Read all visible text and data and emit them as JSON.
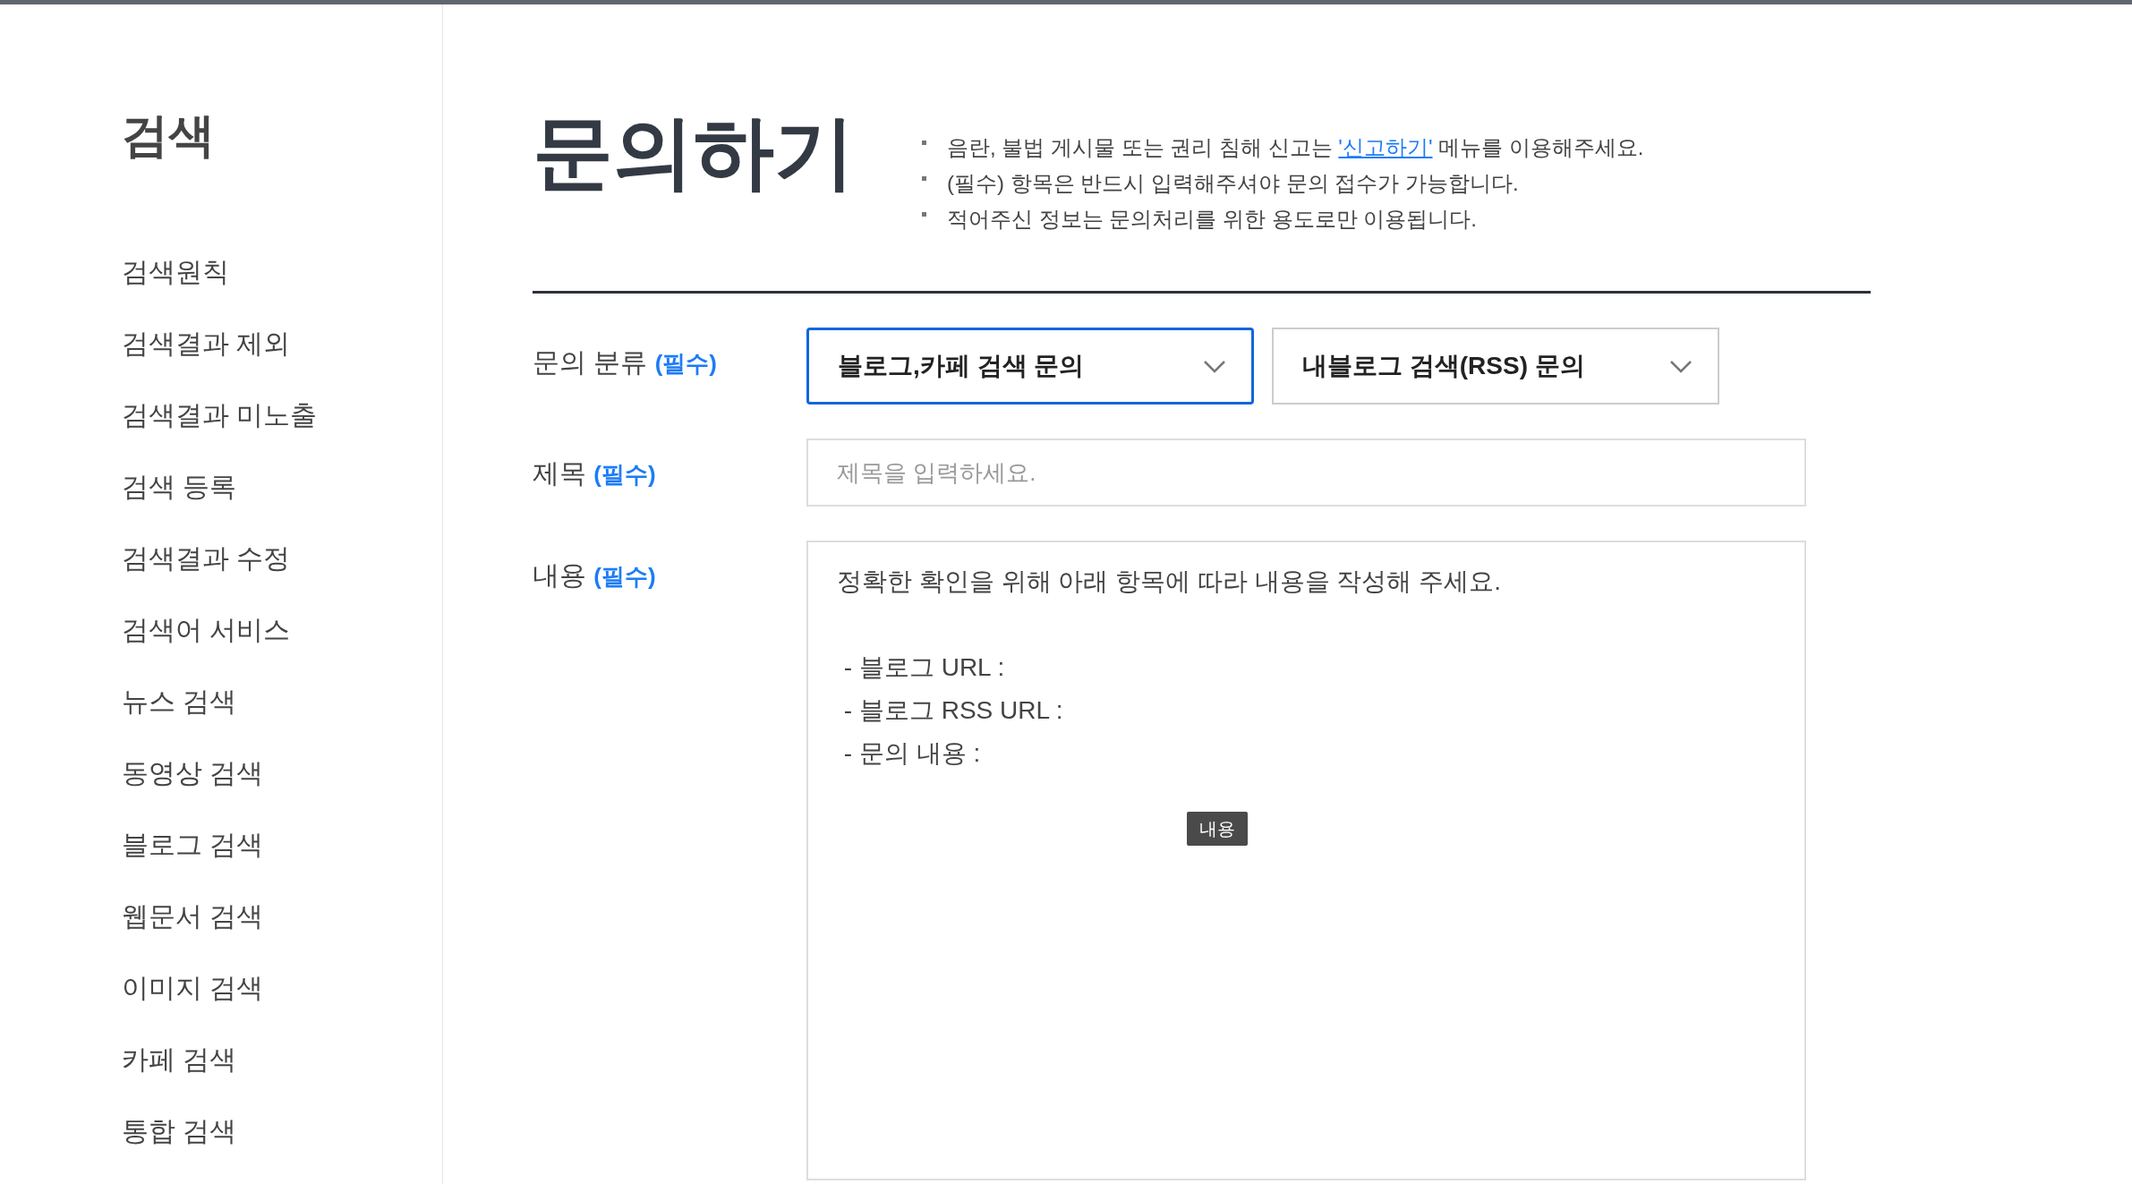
{
  "sidebar": {
    "title": "검색",
    "items": [
      {
        "label": "검색원칙",
        "selected": false
      },
      {
        "label": "검색결과 제외",
        "selected": false
      },
      {
        "label": "검색결과 미노출",
        "selected": false
      },
      {
        "label": "검색 등록",
        "selected": false
      },
      {
        "label": "검색결과 수정",
        "selected": false
      },
      {
        "label": "검색어 서비스",
        "selected": false
      },
      {
        "label": "뉴스 검색",
        "selected": false
      },
      {
        "label": "동영상 검색",
        "selected": false
      },
      {
        "label": "블로그 검색",
        "selected": false
      },
      {
        "label": "웹문서 검색",
        "selected": false
      },
      {
        "label": "이미지 검색",
        "selected": false
      },
      {
        "label": "카페 검색",
        "selected": false
      },
      {
        "label": "통합 검색",
        "selected": false
      }
    ]
  },
  "page": {
    "title": "문의하기",
    "notes": [
      {
        "before": "음란, 불법 게시물 또는 권리 침해 신고는 ",
        "link": "'신고하기'",
        "after": " 메뉴를 이용해주세요."
      },
      {
        "before": "(필수) 항목은 반드시 입력해주셔야 문의 접수가 가능합니다."
      },
      {
        "before": "적어주신 정보는 문의처리를 위한 용도로만 이용됩니다."
      }
    ]
  },
  "form": {
    "category": {
      "label": "문의 분류 **(필수)**",
      "dropdowns": [
        {
          "value": "블로그,카페 검색 문의",
          "focused": true
        },
        {
          "value": "내블로그 검색(RSS) 문의",
          "focused": false
        }
      ]
    },
    "subject": {
      "label": "제목 **(필수)**",
      "placeholder": "제목을 입력하세요."
    },
    "content": {
      "label": "내용 **(필수)**",
      "value": "정확한 확인을 위해 아래 항목에 따라 내용을 작성해 주세요.\n\n - 블로그 URL :\n - 블로그 RSS URL :\n - 문의 내용 :",
      "tooltip": "내용"
    }
  }
}
